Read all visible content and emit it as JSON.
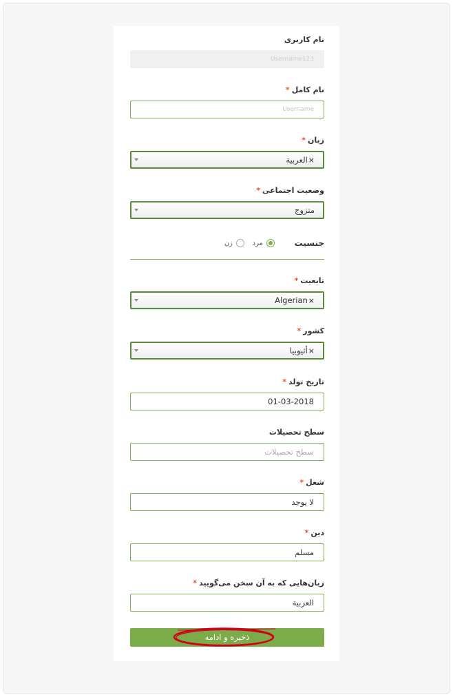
{
  "form": {
    "username": {
      "label": "نام کاربری",
      "value": "Username123"
    },
    "full_name": {
      "label": "نام کامل",
      "value": "Username"
    },
    "language": {
      "label": "زبان",
      "value": "العربية",
      "clear": "×"
    },
    "marital": {
      "label": "وضعیت اجتماعی",
      "value": "متزوج"
    },
    "gender": {
      "label": "جنسیت",
      "options": [
        "مرد",
        "زن"
      ],
      "selected": "مرد"
    },
    "nationality": {
      "label": "تابعیت",
      "value": "Algerian",
      "clear": "×"
    },
    "country": {
      "label": "کشور",
      "value": "أثيوبيا",
      "clear": "×"
    },
    "birth_date": {
      "label": "تاریخ تولد",
      "value": "01-03-2018"
    },
    "education": {
      "label": "سطح تحصیلات",
      "placeholder": "سطح تحصیلات"
    },
    "job": {
      "label": "شغل",
      "value": "لا يوجد"
    },
    "religion": {
      "label": "دین",
      "value": "مسلم"
    },
    "spoken_languages": {
      "label": "زبان‌هایی که به آن سخن می‌گویید",
      "value": "العربية"
    },
    "required_mark": "*",
    "submit_label": "ذخیره و ادامه"
  },
  "colors": {
    "accent": "#7cac4a",
    "required": "#e8541e",
    "annotation": "#d0021b"
  }
}
